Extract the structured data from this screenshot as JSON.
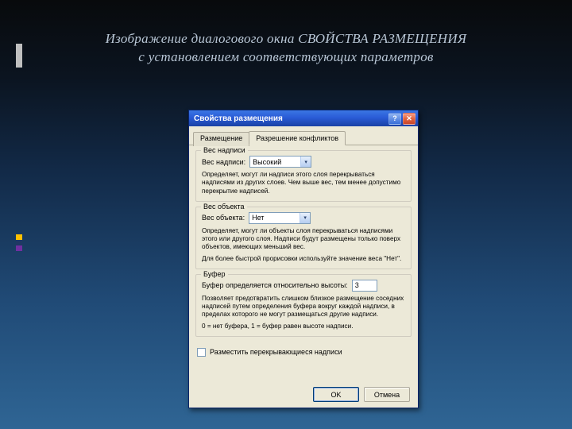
{
  "slide": {
    "title_line1": "Изображение  диалогового  окна  СВОЙСТВА  РАЗМЕЩЕНИЯ",
    "title_line2": "с  установлением  соответствующих  параметров"
  },
  "dialog": {
    "title": "Свойства размещения",
    "help_glyph": "?",
    "close_glyph": "✕",
    "tabs": {
      "placement": "Размещение",
      "conflicts": "Разрешение конфликтов"
    },
    "group_label_weight": {
      "legend": "Вес надписи",
      "label": "Вес надписи:",
      "value": "Высокий",
      "desc": "Определяет, могут ли надписи этого слоя перекрываться надписями из других слоев. Чем выше вес, тем менее допустимо перекрытие надписей."
    },
    "group_object_weight": {
      "legend": "Вес объекта",
      "label": "Вес объекта:",
      "value": "Нет",
      "desc1": "Определяет, могут ли объекты слоя перекрываться надписями этого или другого слоя. Надписи будут размещены только поверх объектов, имеющих меньший вес.",
      "desc2": "Для более быстрой прорисовки используйте значение веса \"Нет\"."
    },
    "group_buffer": {
      "legend": "Буфер",
      "label": "Буфер определяется относительно высоты:",
      "value": "3",
      "desc1": "Позволяет предотвратить слишком близкое размещение соседних надписей путем определения буфера вокруг каждой надписи, в пределах которого не могут размещаться другие надписи.",
      "desc2": "0 = нет буфера, 1 = буфер равен высоте надписи."
    },
    "checkbox_overlap": "Разместить перекрывающиеся надписи",
    "buttons": {
      "ok": "OK",
      "cancel": "Отмена"
    }
  },
  "edge_colors": [
    "#bfbfbf",
    "#bfbfbf",
    "#bfbfbf",
    "#bfbfbf",
    "#bfbfbf"
  ],
  "accent_colors": [
    "#ffc000",
    "#203864",
    "#7030a0"
  ]
}
